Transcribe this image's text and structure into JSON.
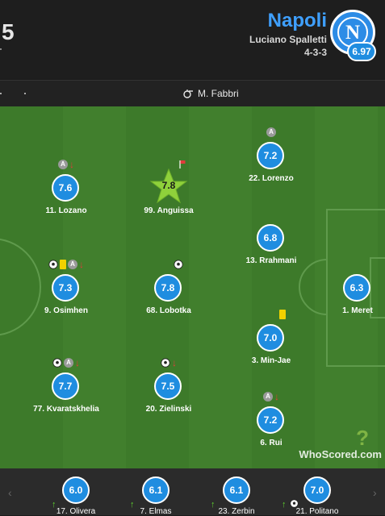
{
  "header": {
    "score_fragment": "5",
    "team_name": "Napoli",
    "manager": "Luciano Spalletti",
    "formation": "4-3-3",
    "crest_letter": "N",
    "team_rating": "6.97"
  },
  "referee": {
    "name": "M. Fabbri"
  },
  "players": [
    {
      "number_name": "11. Lozano",
      "rating": "7.6"
    },
    {
      "number_name": "99. Anguissa",
      "rating": "7.8"
    },
    {
      "number_name": "22. Lorenzo",
      "rating": "7.2"
    },
    {
      "number_name": "13. Rrahmani",
      "rating": "6.8"
    },
    {
      "number_name": "9. Osimhen",
      "rating": "7.3"
    },
    {
      "number_name": "68. Lobotka",
      "rating": "7.8"
    },
    {
      "number_name": "1. Meret",
      "rating": "6.3"
    },
    {
      "number_name": "3. Min-Jae",
      "rating": "7.0"
    },
    {
      "number_name": "77. Kvaratskhelia",
      "rating": "7.7"
    },
    {
      "number_name": "20. Zielinski",
      "rating": "7.5"
    },
    {
      "number_name": "6. Rui",
      "rating": "7.2"
    }
  ],
  "event_labels": {
    "assist": "A"
  },
  "brand": {
    "whoscored": "WhoScored.com",
    "whoscored_mark": "?"
  },
  "subs": [
    {
      "number_name": "17. Olivera",
      "rating": "6.0"
    },
    {
      "number_name": "7. Elmas",
      "rating": "6.1"
    },
    {
      "number_name": "23. Zerbin",
      "rating": "6.1"
    },
    {
      "number_name": "21. Politano",
      "rating": "7.0"
    }
  ],
  "bench_nav": {
    "prev": "‹",
    "next": "›"
  },
  "colors": {
    "rating_blue": "#1f8de0",
    "pitch_green": "#3d7a2a",
    "team_blue": "#3fa0ff",
    "motm_star": "#8fd13b"
  }
}
